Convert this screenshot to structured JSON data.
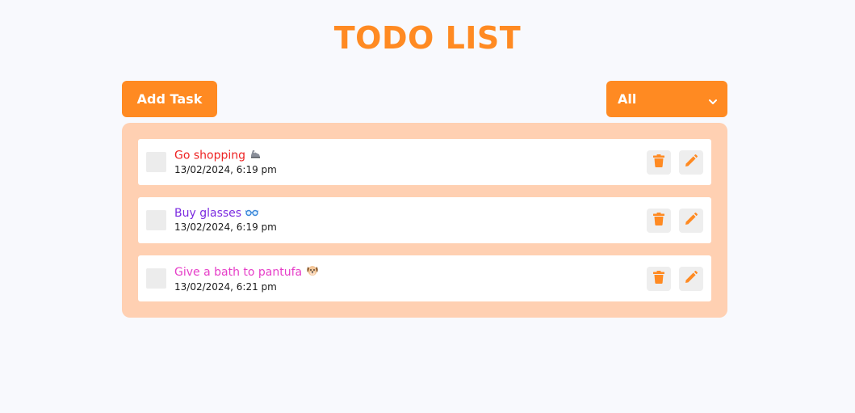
{
  "title": "TODO LIST",
  "toolbar": {
    "add_label": "Add Task",
    "filter_value": "All"
  },
  "colors": {
    "accent": "#ff8a22",
    "panel": "#ffd0b2",
    "background": "#f8f9fd"
  },
  "tasks": [
    {
      "title": "Go shopping",
      "time": "13/02/2024, 6:19 pm",
      "color": "#ee2323",
      "emoji_icon": "sneaker-icon"
    },
    {
      "title": "Buy glasses",
      "time": "13/02/2024, 6:19 pm",
      "color": "#7b2be0",
      "emoji_icon": "glasses-icon"
    },
    {
      "title": "Give a bath to pantufa",
      "time": "13/02/2024, 6:21 pm",
      "color": "#e63ec8",
      "emoji_icon": "dog-face-icon"
    }
  ]
}
